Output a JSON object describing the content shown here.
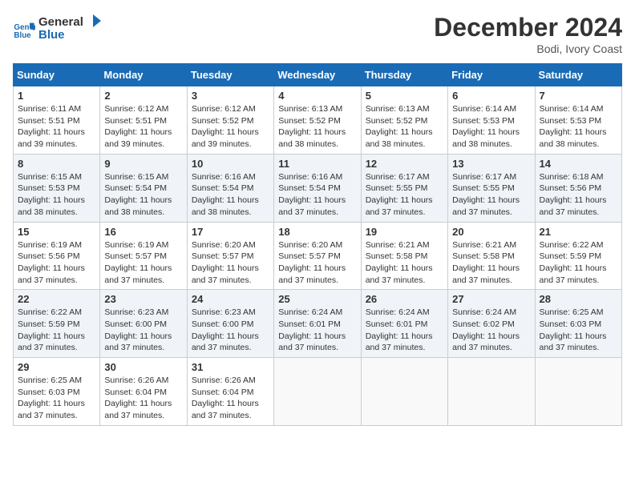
{
  "header": {
    "logo_line1": "General",
    "logo_line2": "Blue",
    "month_title": "December 2024",
    "location": "Bodi, Ivory Coast"
  },
  "weekdays": [
    "Sunday",
    "Monday",
    "Tuesday",
    "Wednesday",
    "Thursday",
    "Friday",
    "Saturday"
  ],
  "weeks": [
    [
      {
        "day": "1",
        "sunrise": "6:11 AM",
        "sunset": "5:51 PM",
        "daylight": "11 hours and 39 minutes."
      },
      {
        "day": "2",
        "sunrise": "6:12 AM",
        "sunset": "5:51 PM",
        "daylight": "11 hours and 39 minutes."
      },
      {
        "day": "3",
        "sunrise": "6:12 AM",
        "sunset": "5:52 PM",
        "daylight": "11 hours and 39 minutes."
      },
      {
        "day": "4",
        "sunrise": "6:13 AM",
        "sunset": "5:52 PM",
        "daylight": "11 hours and 38 minutes."
      },
      {
        "day": "5",
        "sunrise": "6:13 AM",
        "sunset": "5:52 PM",
        "daylight": "11 hours and 38 minutes."
      },
      {
        "day": "6",
        "sunrise": "6:14 AM",
        "sunset": "5:53 PM",
        "daylight": "11 hours and 38 minutes."
      },
      {
        "day": "7",
        "sunrise": "6:14 AM",
        "sunset": "5:53 PM",
        "daylight": "11 hours and 38 minutes."
      }
    ],
    [
      {
        "day": "8",
        "sunrise": "6:15 AM",
        "sunset": "5:53 PM",
        "daylight": "11 hours and 38 minutes."
      },
      {
        "day": "9",
        "sunrise": "6:15 AM",
        "sunset": "5:54 PM",
        "daylight": "11 hours and 38 minutes."
      },
      {
        "day": "10",
        "sunrise": "6:16 AM",
        "sunset": "5:54 PM",
        "daylight": "11 hours and 38 minutes."
      },
      {
        "day": "11",
        "sunrise": "6:16 AM",
        "sunset": "5:54 PM",
        "daylight": "11 hours and 37 minutes."
      },
      {
        "day": "12",
        "sunrise": "6:17 AM",
        "sunset": "5:55 PM",
        "daylight": "11 hours and 37 minutes."
      },
      {
        "day": "13",
        "sunrise": "6:17 AM",
        "sunset": "5:55 PM",
        "daylight": "11 hours and 37 minutes."
      },
      {
        "day": "14",
        "sunrise": "6:18 AM",
        "sunset": "5:56 PM",
        "daylight": "11 hours and 37 minutes."
      }
    ],
    [
      {
        "day": "15",
        "sunrise": "6:19 AM",
        "sunset": "5:56 PM",
        "daylight": "11 hours and 37 minutes."
      },
      {
        "day": "16",
        "sunrise": "6:19 AM",
        "sunset": "5:57 PM",
        "daylight": "11 hours and 37 minutes."
      },
      {
        "day": "17",
        "sunrise": "6:20 AM",
        "sunset": "5:57 PM",
        "daylight": "11 hours and 37 minutes."
      },
      {
        "day": "18",
        "sunrise": "6:20 AM",
        "sunset": "5:57 PM",
        "daylight": "11 hours and 37 minutes."
      },
      {
        "day": "19",
        "sunrise": "6:21 AM",
        "sunset": "5:58 PM",
        "daylight": "11 hours and 37 minutes."
      },
      {
        "day": "20",
        "sunrise": "6:21 AM",
        "sunset": "5:58 PM",
        "daylight": "11 hours and 37 minutes."
      },
      {
        "day": "21",
        "sunrise": "6:22 AM",
        "sunset": "5:59 PM",
        "daylight": "11 hours and 37 minutes."
      }
    ],
    [
      {
        "day": "22",
        "sunrise": "6:22 AM",
        "sunset": "5:59 PM",
        "daylight": "11 hours and 37 minutes."
      },
      {
        "day": "23",
        "sunrise": "6:23 AM",
        "sunset": "6:00 PM",
        "daylight": "11 hours and 37 minutes."
      },
      {
        "day": "24",
        "sunrise": "6:23 AM",
        "sunset": "6:00 PM",
        "daylight": "11 hours and 37 minutes."
      },
      {
        "day": "25",
        "sunrise": "6:24 AM",
        "sunset": "6:01 PM",
        "daylight": "11 hours and 37 minutes."
      },
      {
        "day": "26",
        "sunrise": "6:24 AM",
        "sunset": "6:01 PM",
        "daylight": "11 hours and 37 minutes."
      },
      {
        "day": "27",
        "sunrise": "6:24 AM",
        "sunset": "6:02 PM",
        "daylight": "11 hours and 37 minutes."
      },
      {
        "day": "28",
        "sunrise": "6:25 AM",
        "sunset": "6:03 PM",
        "daylight": "11 hours and 37 minutes."
      }
    ],
    [
      {
        "day": "29",
        "sunrise": "6:25 AM",
        "sunset": "6:03 PM",
        "daylight": "11 hours and 37 minutes."
      },
      {
        "day": "30",
        "sunrise": "6:26 AM",
        "sunset": "6:04 PM",
        "daylight": "11 hours and 37 minutes."
      },
      {
        "day": "31",
        "sunrise": "6:26 AM",
        "sunset": "6:04 PM",
        "daylight": "11 hours and 37 minutes."
      },
      null,
      null,
      null,
      null
    ]
  ],
  "labels": {
    "sunrise": "Sunrise:",
    "sunset": "Sunset:",
    "daylight": "Daylight:"
  }
}
